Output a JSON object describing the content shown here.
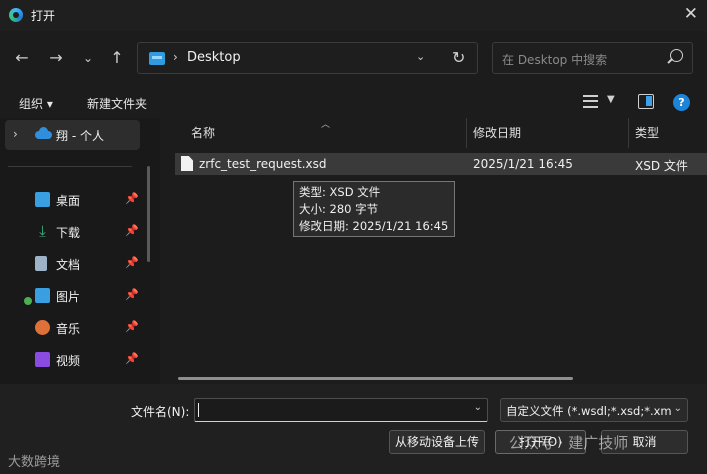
{
  "window": {
    "title": "打开"
  },
  "address": {
    "location": "Desktop"
  },
  "search": {
    "placeholder": "在 Desktop 中搜索"
  },
  "commands": {
    "organize": "组织 ▾",
    "new_folder": "新建文件夹"
  },
  "sidebar": {
    "onedrive": "翔 - 个人",
    "items": [
      {
        "label": "桌面",
        "icon": "desktop-icon",
        "color": "#3a9fe0"
      },
      {
        "label": "下载",
        "icon": "download-icon",
        "color": "#3fb27f"
      },
      {
        "label": "文档",
        "icon": "document-icon",
        "color": "#9fb3c8"
      },
      {
        "label": "图片",
        "icon": "pictures-icon",
        "color": "#3a9fe0"
      },
      {
        "label": "音乐",
        "icon": "music-icon",
        "color": "#e0703a"
      },
      {
        "label": "视频",
        "icon": "video-icon",
        "color": "#8a4be0"
      }
    ]
  },
  "columns": {
    "name": "名称",
    "date": "修改日期",
    "type": "类型"
  },
  "files": [
    {
      "name": "zrfc_test_request.xsd",
      "date": "2025/1/21 16:45",
      "type": "XSD 文件"
    }
  ],
  "tooltip": {
    "type": "类型: XSD 文件",
    "size": "大小: 280 字节",
    "date": "修改日期: 2025/1/21 16:45"
  },
  "bottom": {
    "filename_label": "文件名(N):",
    "filename_value": "",
    "filetype": "自定义文件 (*.wsdl;*.xsd;*.xml",
    "mobile_button": "从移动设备上传",
    "open_button": "打开(O)",
    "cancel_button": "取消"
  },
  "watermark": {
    "left": "大数跨境",
    "right": "公众号 · 建广技师"
  }
}
